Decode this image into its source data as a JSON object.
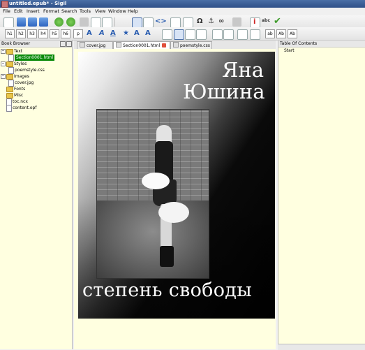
{
  "window": {
    "title": "untitled.epub* - Sigil"
  },
  "menu": [
    "File",
    "Edit",
    "Insert",
    "Format",
    "Search",
    "Tools",
    "View",
    "Window",
    "Help"
  ],
  "heading_buttons": [
    "h1",
    "h2",
    "h3",
    "h4",
    "h5",
    "h6",
    "p"
  ],
  "style_buttons": [
    "ab",
    "Ab",
    "Ab"
  ],
  "book_browser": {
    "title": "Book Browser",
    "tree": [
      {
        "label": "Text",
        "kind": "folder"
      },
      {
        "label": "Section0001.html",
        "kind": "file",
        "selected": true
      },
      {
        "label": "Styles",
        "kind": "folder"
      },
      {
        "label": "poemstyle.css",
        "kind": "file"
      },
      {
        "label": "Images",
        "kind": "folder"
      },
      {
        "label": "cover.jpg",
        "kind": "file"
      },
      {
        "label": "Fonts",
        "kind": "folder"
      },
      {
        "label": "Misc",
        "kind": "folder"
      },
      {
        "label": "toc.ncx",
        "kind": "file"
      },
      {
        "label": "content.opf",
        "kind": "file"
      }
    ]
  },
  "tabs": [
    {
      "label": "cover.jpg",
      "active": false
    },
    {
      "label": "Section0001.html",
      "active": true
    },
    {
      "label": "poemstyle.css",
      "active": false
    }
  ],
  "cover": {
    "author_first": "Яна",
    "author_last": "Юшина",
    "title": "степень свободы"
  },
  "toc": {
    "title": "Table Of Contents",
    "items": [
      "Start"
    ]
  },
  "colors": {
    "selection": "#0a8a0a",
    "panel_bg": "#ffffe0",
    "titlebar": "#3a5e98"
  }
}
